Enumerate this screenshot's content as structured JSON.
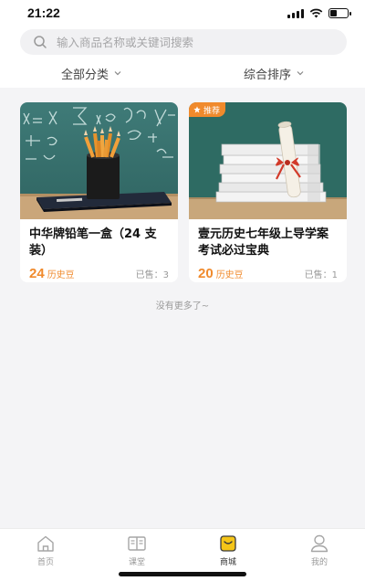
{
  "status": {
    "time": "21:22"
  },
  "search": {
    "placeholder": "输入商品名称或关键词搜索"
  },
  "filters": {
    "category_label": "全部分类",
    "sort_label": "综合排序"
  },
  "products": [
    {
      "title": "中华牌铅笔一盒（24 支装）",
      "price": "24",
      "unit": "历史豆",
      "sold": "已售：3",
      "badge": ""
    },
    {
      "title": "壹元历史七年级上导学案考试必过宝典",
      "price": "20",
      "unit": "历史豆",
      "sold": "已售：1",
      "badge": "推荐"
    }
  ],
  "list_end_text": "没有更多了~",
  "tabbar": {
    "items": [
      {
        "label": "首页",
        "icon": "home-icon"
      },
      {
        "label": "课堂",
        "icon": "book-icon"
      },
      {
        "label": "商城",
        "icon": "shop-icon"
      },
      {
        "label": "我的",
        "icon": "profile-icon"
      }
    ],
    "active": 2
  },
  "colors": {
    "accent": "#f08a2c",
    "active_tab": "#f5c518"
  }
}
